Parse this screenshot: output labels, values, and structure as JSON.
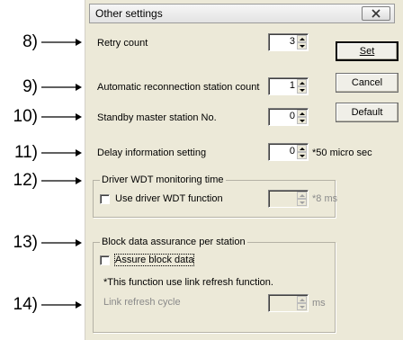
{
  "callouts": [
    "8)",
    "9)",
    "10)",
    "11)",
    "12)",
    "13)",
    "14)"
  ],
  "dialog": {
    "title": "Other settings",
    "close_icon": "close-x-icon"
  },
  "fields": {
    "retry_count": {
      "label": "Retry count",
      "value": "3"
    },
    "reconnection": {
      "label": "Automatic reconnection station count",
      "value": "1"
    },
    "standby": {
      "label": "Standby master station No.",
      "value": "0"
    },
    "delay": {
      "label": "Delay information setting",
      "value": "0",
      "unit": "*50 micro sec"
    }
  },
  "buttons": {
    "set": "Set",
    "cancel": "Cancel",
    "default": "Default"
  },
  "wdt_group": {
    "legend": "Driver WDT monitoring time",
    "checkbox_label": "Use driver WDT function",
    "checked": false,
    "value": "",
    "unit": "*8 ms"
  },
  "block_group": {
    "legend": "Block data assurance per station",
    "checkbox_label": "Assure block data",
    "checked": false,
    "note": "*This function use link refresh function.",
    "cycle_label": "Link refresh cycle",
    "value": "",
    "unit": "ms"
  }
}
